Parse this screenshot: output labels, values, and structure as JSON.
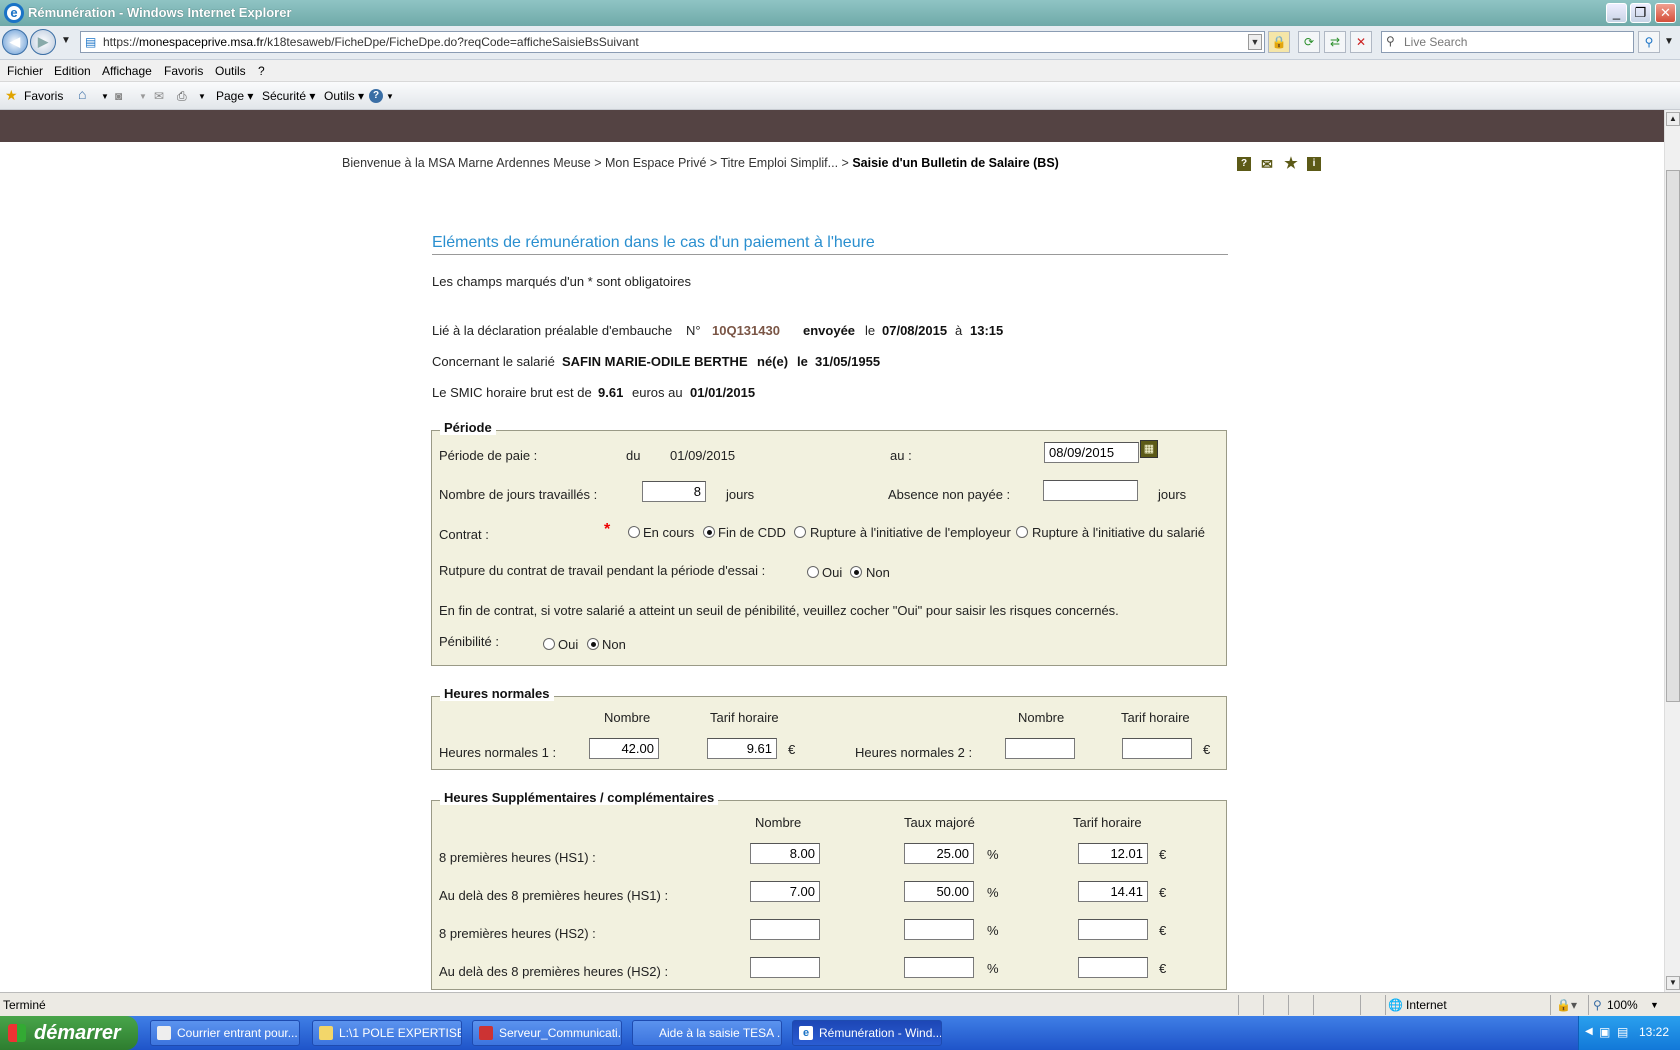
{
  "window": {
    "title": "Rémunération - Windows Internet Explorer"
  },
  "address": {
    "url_prefix": "https://",
    "url_host": "monespaceprive.msa.fr",
    "url_path": "/k18tesaweb/FicheDpe/FicheDpe.do?reqCode=afficheSaisieBsSuivant",
    "search_placeholder": "Live Search"
  },
  "menu": [
    "Fichier",
    "Edition",
    "Affichage",
    "Favoris",
    "Outils",
    "?"
  ],
  "commandbar": {
    "favorites": "Favoris",
    "page": "Page",
    "security": "Sécurité",
    "tools": "Outils"
  },
  "breadcrumb": {
    "path": "Bienvenue à la MSA Marne Ardennes Meuse > Mon Espace Privé > Titre Emploi Simplif... > ",
    "current": "Saisie d'un Bulletin de Salaire (BS)"
  },
  "heading": "Eléments de rémunération dans le cas d'un paiement à l'heure",
  "mandatory_note": "Les champs marqués d'un * sont obligatoires",
  "declaration": {
    "label": "Lié à la déclaration préalable d'embauche",
    "num_label": "N°",
    "num": "10Q131430",
    "sent_label": "envoyée",
    "le": "le",
    "date": "07/08/2015",
    "a": "à",
    "time": "13:15"
  },
  "employee": {
    "label": "Concernant le salarié",
    "name": "SAFIN  MARIE-ODILE BERTHE",
    "born_label": "né(e)",
    "le": "le",
    "birth": "31/05/1955"
  },
  "smic": {
    "label": "Le SMIC horaire brut est de",
    "value": "9.61",
    "unit": "euros au",
    "date": "01/01/2015"
  },
  "periode": {
    "legend": "Période",
    "pay_label": "Période de paie :",
    "du": "du",
    "from": "01/09/2015",
    "au": "au :",
    "to": "08/09/2015",
    "days_label": "Nombre de jours travaillés :",
    "days": "8",
    "days_unit": "jours",
    "absence_label": "Absence non payée :",
    "absence": "",
    "absence_unit": "jours",
    "contract_label": "Contrat :",
    "contract_options": [
      "En cours",
      "Fin de CDD",
      "Rupture à l'initiative de l'employeur",
      "Rupture à l'initiative du salarié"
    ],
    "contract_selected": "Fin de CDD",
    "trial_label": "Rutpure du contrat de travail pendant la période d'essai :",
    "oui": "Oui",
    "non": "Non",
    "trial_selected": "Non",
    "penibility_note": "En fin de contrat, si votre salarié a atteint un seuil de pénibilité, veuillez cocher \"Oui\" pour saisir les risques concernés.",
    "penibility_label": "Pénibilité :",
    "penibility_selected": "Non"
  },
  "normal_hours": {
    "legend": "Heures normales",
    "col_nombre": "Nombre",
    "col_tarif": "Tarif horaire",
    "row1_label": "Heures normales 1 :",
    "row1_nombre": "42.00",
    "row1_tarif": "9.61",
    "row2_label": "Heures normales 2 :",
    "row2_nombre": "",
    "row2_tarif": "",
    "euro": "€"
  },
  "extra_hours": {
    "legend": "Heures Supplémentaires / complémentaires",
    "col_nombre": "Nombre",
    "col_taux": "Taux majoré",
    "col_tarif": "Tarif horaire",
    "pct": "%",
    "euro": "€",
    "rows": [
      {
        "label": "8 premières heures (HS1) :",
        "nombre": "8.00",
        "taux": "25.00",
        "tarif": "12.01"
      },
      {
        "label": "Au delà des 8 premières heures (HS1) :",
        "nombre": "7.00",
        "taux": "50.00",
        "tarif": "14.41"
      },
      {
        "label": "8 premières heures (HS2) :",
        "nombre": "",
        "taux": "",
        "tarif": ""
      },
      {
        "label": "Au delà des 8 premières heures (HS2) :",
        "nombre": "",
        "taux": "",
        "tarif": ""
      }
    ]
  },
  "statusbar": {
    "status": "Terminé",
    "zone": "Internet",
    "zoom": "100%"
  },
  "taskbar": {
    "start": "démarrer",
    "tasks": [
      "Courrier entrant pour...",
      "L:\\1 POLE EXPERTISE...",
      "Serveur_Communicati...",
      "Aide à la saisie TESA ...",
      "Rémunération - Wind..."
    ],
    "clock": "13:22"
  }
}
